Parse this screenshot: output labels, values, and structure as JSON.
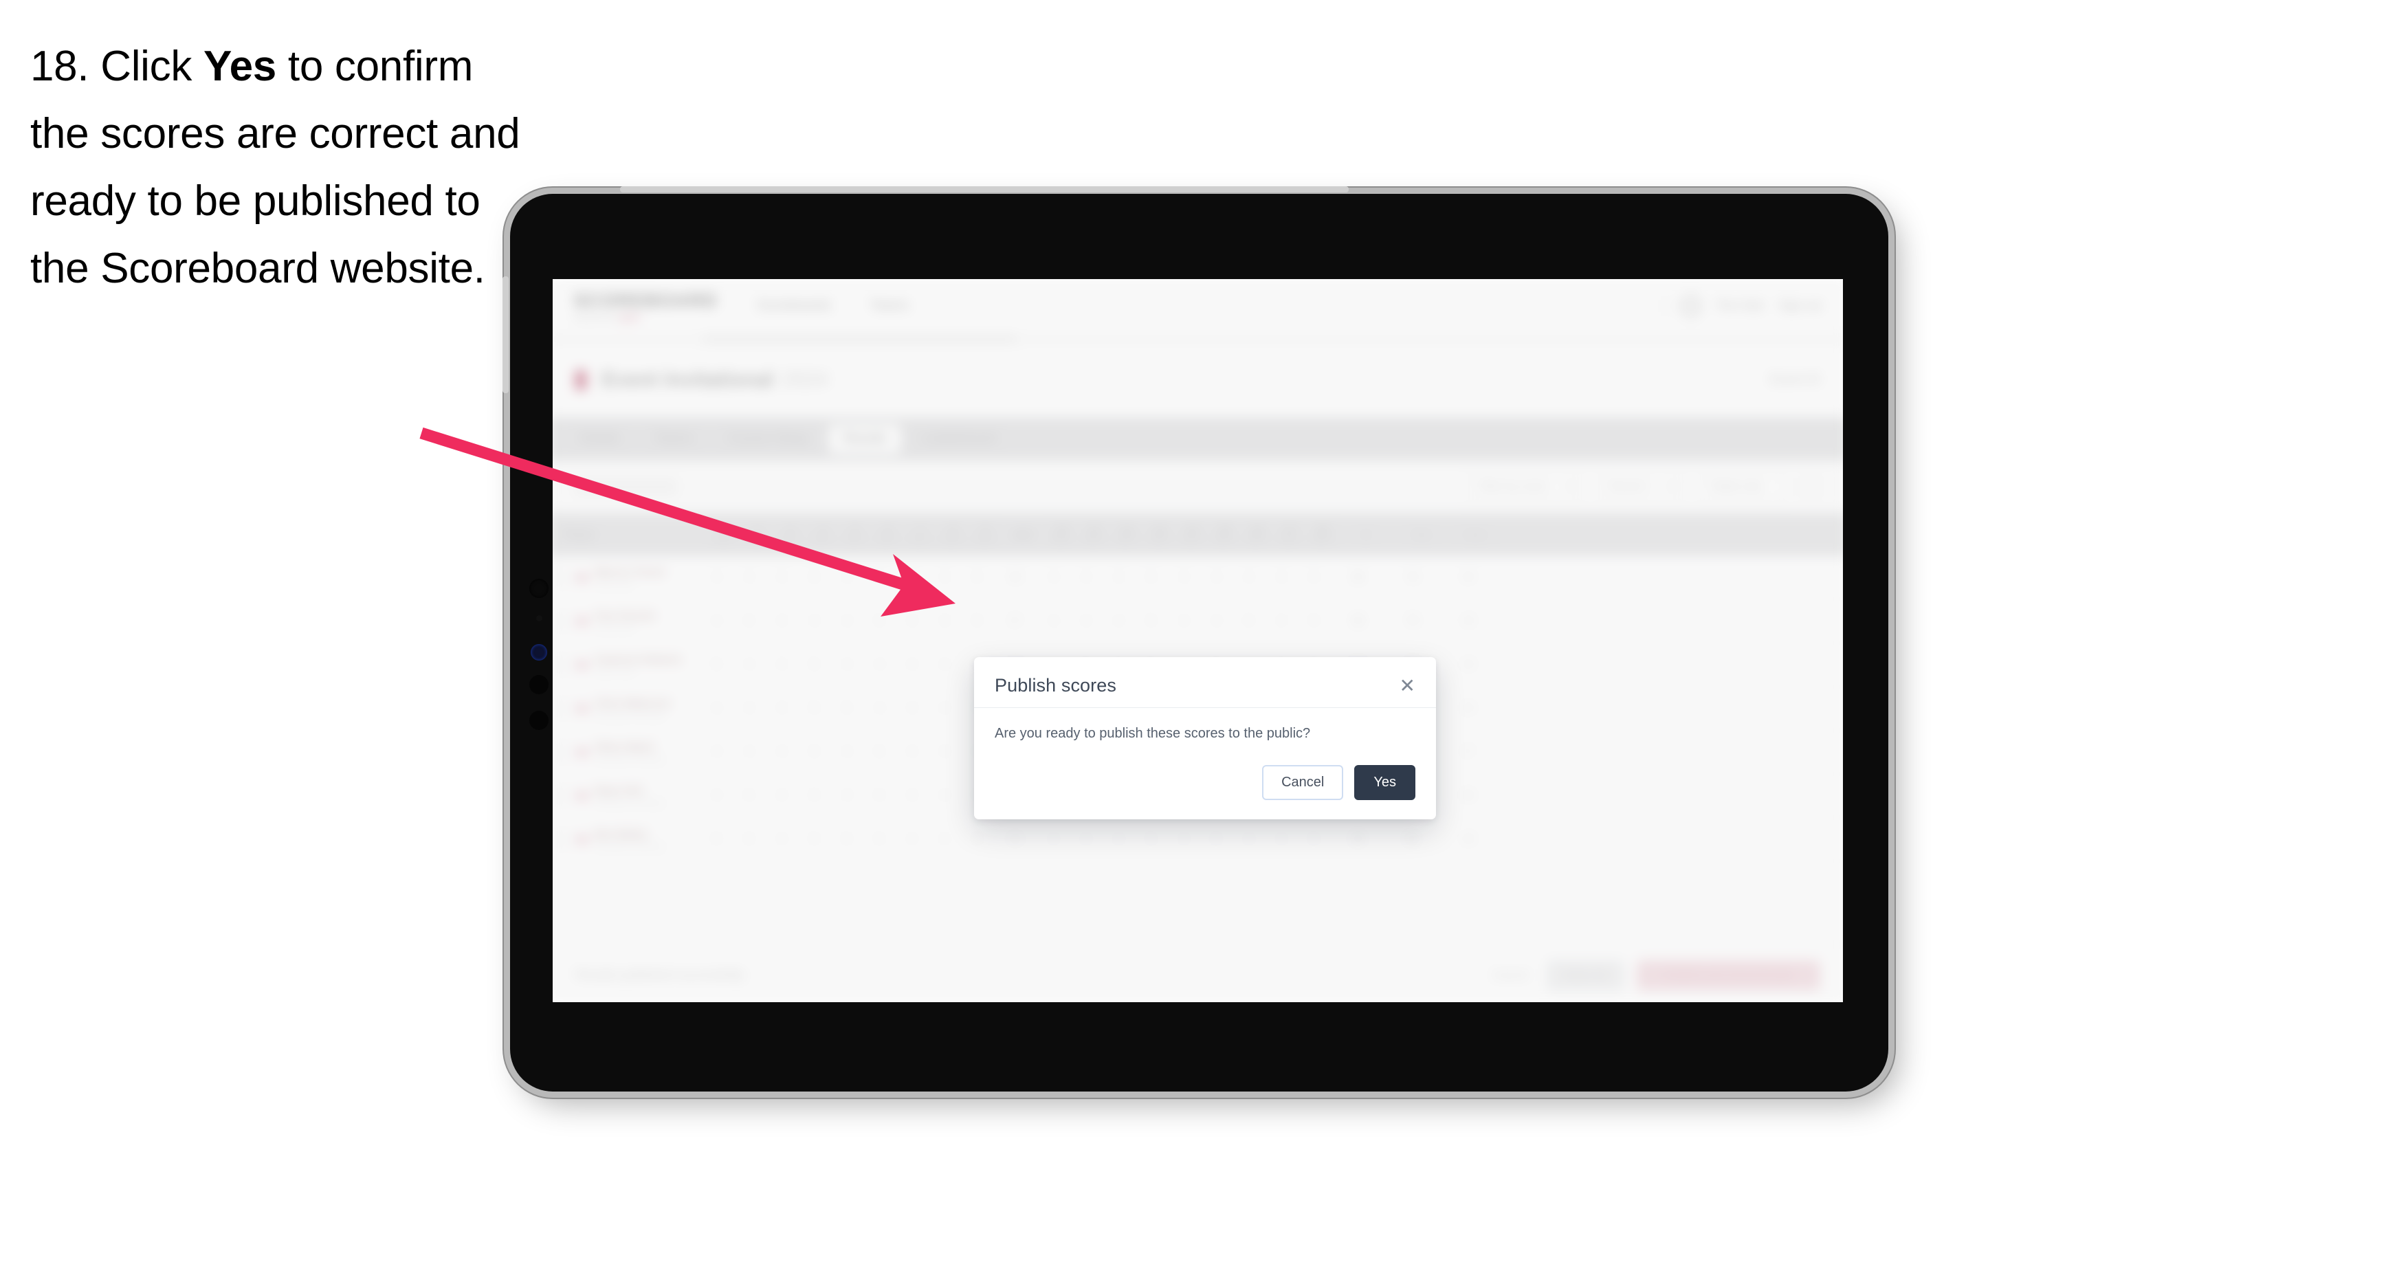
{
  "caption": {
    "prefix": "18. Click ",
    "bold": "Yes",
    "suffix": " to confirm the scores are correct and ready to be published to the Scoreboard website."
  },
  "colors": {
    "arrow": "#ef2b5e",
    "accent_pink": "#ef2b5e",
    "yes_button": "#2f3a4b",
    "cancel_border": "#cfddf2",
    "device_bezel": "#0c0c0c",
    "device_rim": "#b9b9b9"
  },
  "modal": {
    "title": "Publish scores",
    "close_icon": "✕",
    "body": "Are you ready to publish these scores to the public?",
    "cancel_label": "Cancel",
    "yes_label": "Yes"
  },
  "app": {
    "brand": {
      "word": "SCOREBOARD",
      "sub": "powered by ",
      "sub_tag": "sport"
    },
    "nav_links": [
      "Scoreboards",
      "Teams"
    ],
    "nav_right": {
      "user": "The Club",
      "signout": "Sign out"
    },
    "event": {
      "title": "Event Invitational",
      "subtitle": "2024",
      "right": "Event ID"
    },
    "tabs": [
      {
        "label": "Details",
        "active": false
      },
      {
        "label": "Teams",
        "active": false
      },
      {
        "label": "Course Setup",
        "active": false
      },
      {
        "label": "Results",
        "active": true
      },
      {
        "label": "Leaderboard",
        "active": false
      }
    ],
    "filters": {
      "search_placeholder": "Search",
      "pill_1": "Filter by score",
      "pill_2": "Round 1",
      "pill_3": "Totals only"
    },
    "table": {
      "player_header": "Player",
      "hole_numbers": [
        "1",
        "2",
        "3",
        "4",
        "5",
        "6",
        "7",
        "8",
        "9",
        "OUT",
        "10",
        "11",
        "12",
        "13",
        "14",
        "15",
        "16",
        "17",
        "18"
      ],
      "hole_pars": [
        "Par 4",
        "Par 4",
        "Par 3",
        "Par 5",
        "Par 4",
        "Par 4",
        "Par 4",
        "Par 3",
        "Par 5",
        "",
        "Par 4",
        "Par 4",
        "Par 3",
        "Par 5",
        "Par 4",
        "Par 4",
        "Par 4",
        "Par 3",
        "Par 5"
      ],
      "tail_headers": [
        "IN",
        "Total",
        "Score"
      ],
      "rows": [
        {
          "name": "Marcus Turner",
          "club": "Club A Golf",
          "holes": [
            "4",
            "4",
            "3",
            "5",
            "4",
            "4",
            "4",
            "3",
            "5",
            "36",
            "4",
            "4",
            "3",
            "5",
            "4",
            "4",
            "4",
            "3",
            "5"
          ],
          "in": "36",
          "total": "72",
          "score": "+0"
        },
        {
          "name": "Finn Parrish",
          "club": "Club B Golf",
          "holes": [
            "4",
            "5",
            "3",
            "4",
            "4",
            "5",
            "4",
            "3",
            "5",
            "37",
            "4",
            "4",
            "4",
            "5",
            "4",
            "4",
            "5",
            "3",
            "5"
          ],
          "in": "38",
          "total": "75",
          "score": "+3"
        },
        {
          "name": "Cameron Roberts",
          "club": "Club C Golf",
          "holes": [
            "5",
            "4",
            "3",
            "5",
            "4",
            "4",
            "4",
            "4",
            "5",
            "38",
            "4",
            "5",
            "3",
            "5",
            "4",
            "5",
            "4",
            "3",
            "5"
          ],
          "in": "38",
          "total": "76",
          "score": "+4"
        },
        {
          "name": "Chris Waterson",
          "club": "Riverbank University",
          "holes": [
            "4",
            "4",
            "3",
            "5",
            "5",
            "4",
            "4",
            "4",
            "5",
            "38",
            "4",
            "4",
            "4",
            "5",
            "4",
            "4",
            "4",
            "4",
            "5"
          ],
          "in": "38",
          "total": "76",
          "score": "+4"
        },
        {
          "name": "Oliver Baird",
          "club": "Riverbank University",
          "holes": [
            "4",
            "4",
            "4",
            "5",
            "4",
            "5",
            "4",
            "4",
            "5",
            "39",
            "4",
            "5",
            "4",
            "5",
            "5",
            "4",
            "4",
            "4",
            "5"
          ],
          "in": "40",
          "total": "79",
          "score": "+7"
        },
        {
          "name": "Ryan Kirk",
          "club": "Riverbank University",
          "holes": [
            "4",
            "5",
            "4",
            "5",
            "4",
            "5",
            "4",
            "4",
            "5",
            "40",
            "4",
            "4",
            "4",
            "5",
            "4",
            "4",
            "4",
            "4",
            "5"
          ],
          "in": "38",
          "total": "78",
          "score": "+6"
        },
        {
          "name": "Ben Bailey",
          "club": "Riverbank University",
          "holes": [
            "5",
            "5",
            "4",
            "5",
            "5",
            "5",
            "4",
            "4",
            "5",
            "42",
            "4",
            "4",
            "4",
            "5",
            "4",
            "5",
            "4",
            "4",
            "5"
          ],
          "in": "39",
          "total": "81",
          "score": "+9"
        }
      ]
    },
    "footer": {
      "note": "Results published successfully",
      "cancel": "Cancel",
      "save": "Save all",
      "publish": "Publish and Send Emails"
    }
  }
}
